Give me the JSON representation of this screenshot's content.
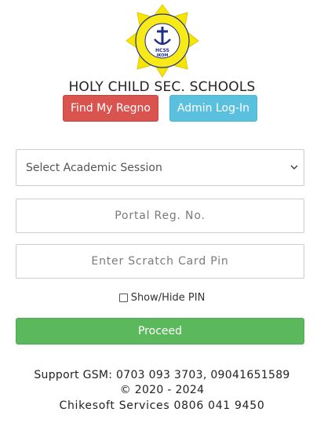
{
  "school": {
    "name": "HOLY CHILD SEC. SCHOOLS",
    "logo_text": "HCSS IKOM",
    "logo_icon": "school-crest"
  },
  "buttons": {
    "find_regno": "Find My Regno",
    "admin_login": "Admin Log-In",
    "proceed": "Proceed"
  },
  "form": {
    "session_select": "Select Academic Session",
    "regno_placeholder": "Portal Reg. No.",
    "pin_placeholder": "Enter Scratch Card Pin",
    "show_hide_label": "Show/Hide PIN"
  },
  "footer": {
    "support": "Support GSM: 0703 093 3703, 09041651589",
    "copyright": "© 2020 - 2024",
    "credits": "Chikesoft Services 0806 041 9450"
  },
  "colors": {
    "danger": "#d9534f",
    "info": "#5bc0de",
    "success": "#5cb85c",
    "logo_yellow": "#f5e500",
    "logo_blue": "#1e2f8a"
  }
}
